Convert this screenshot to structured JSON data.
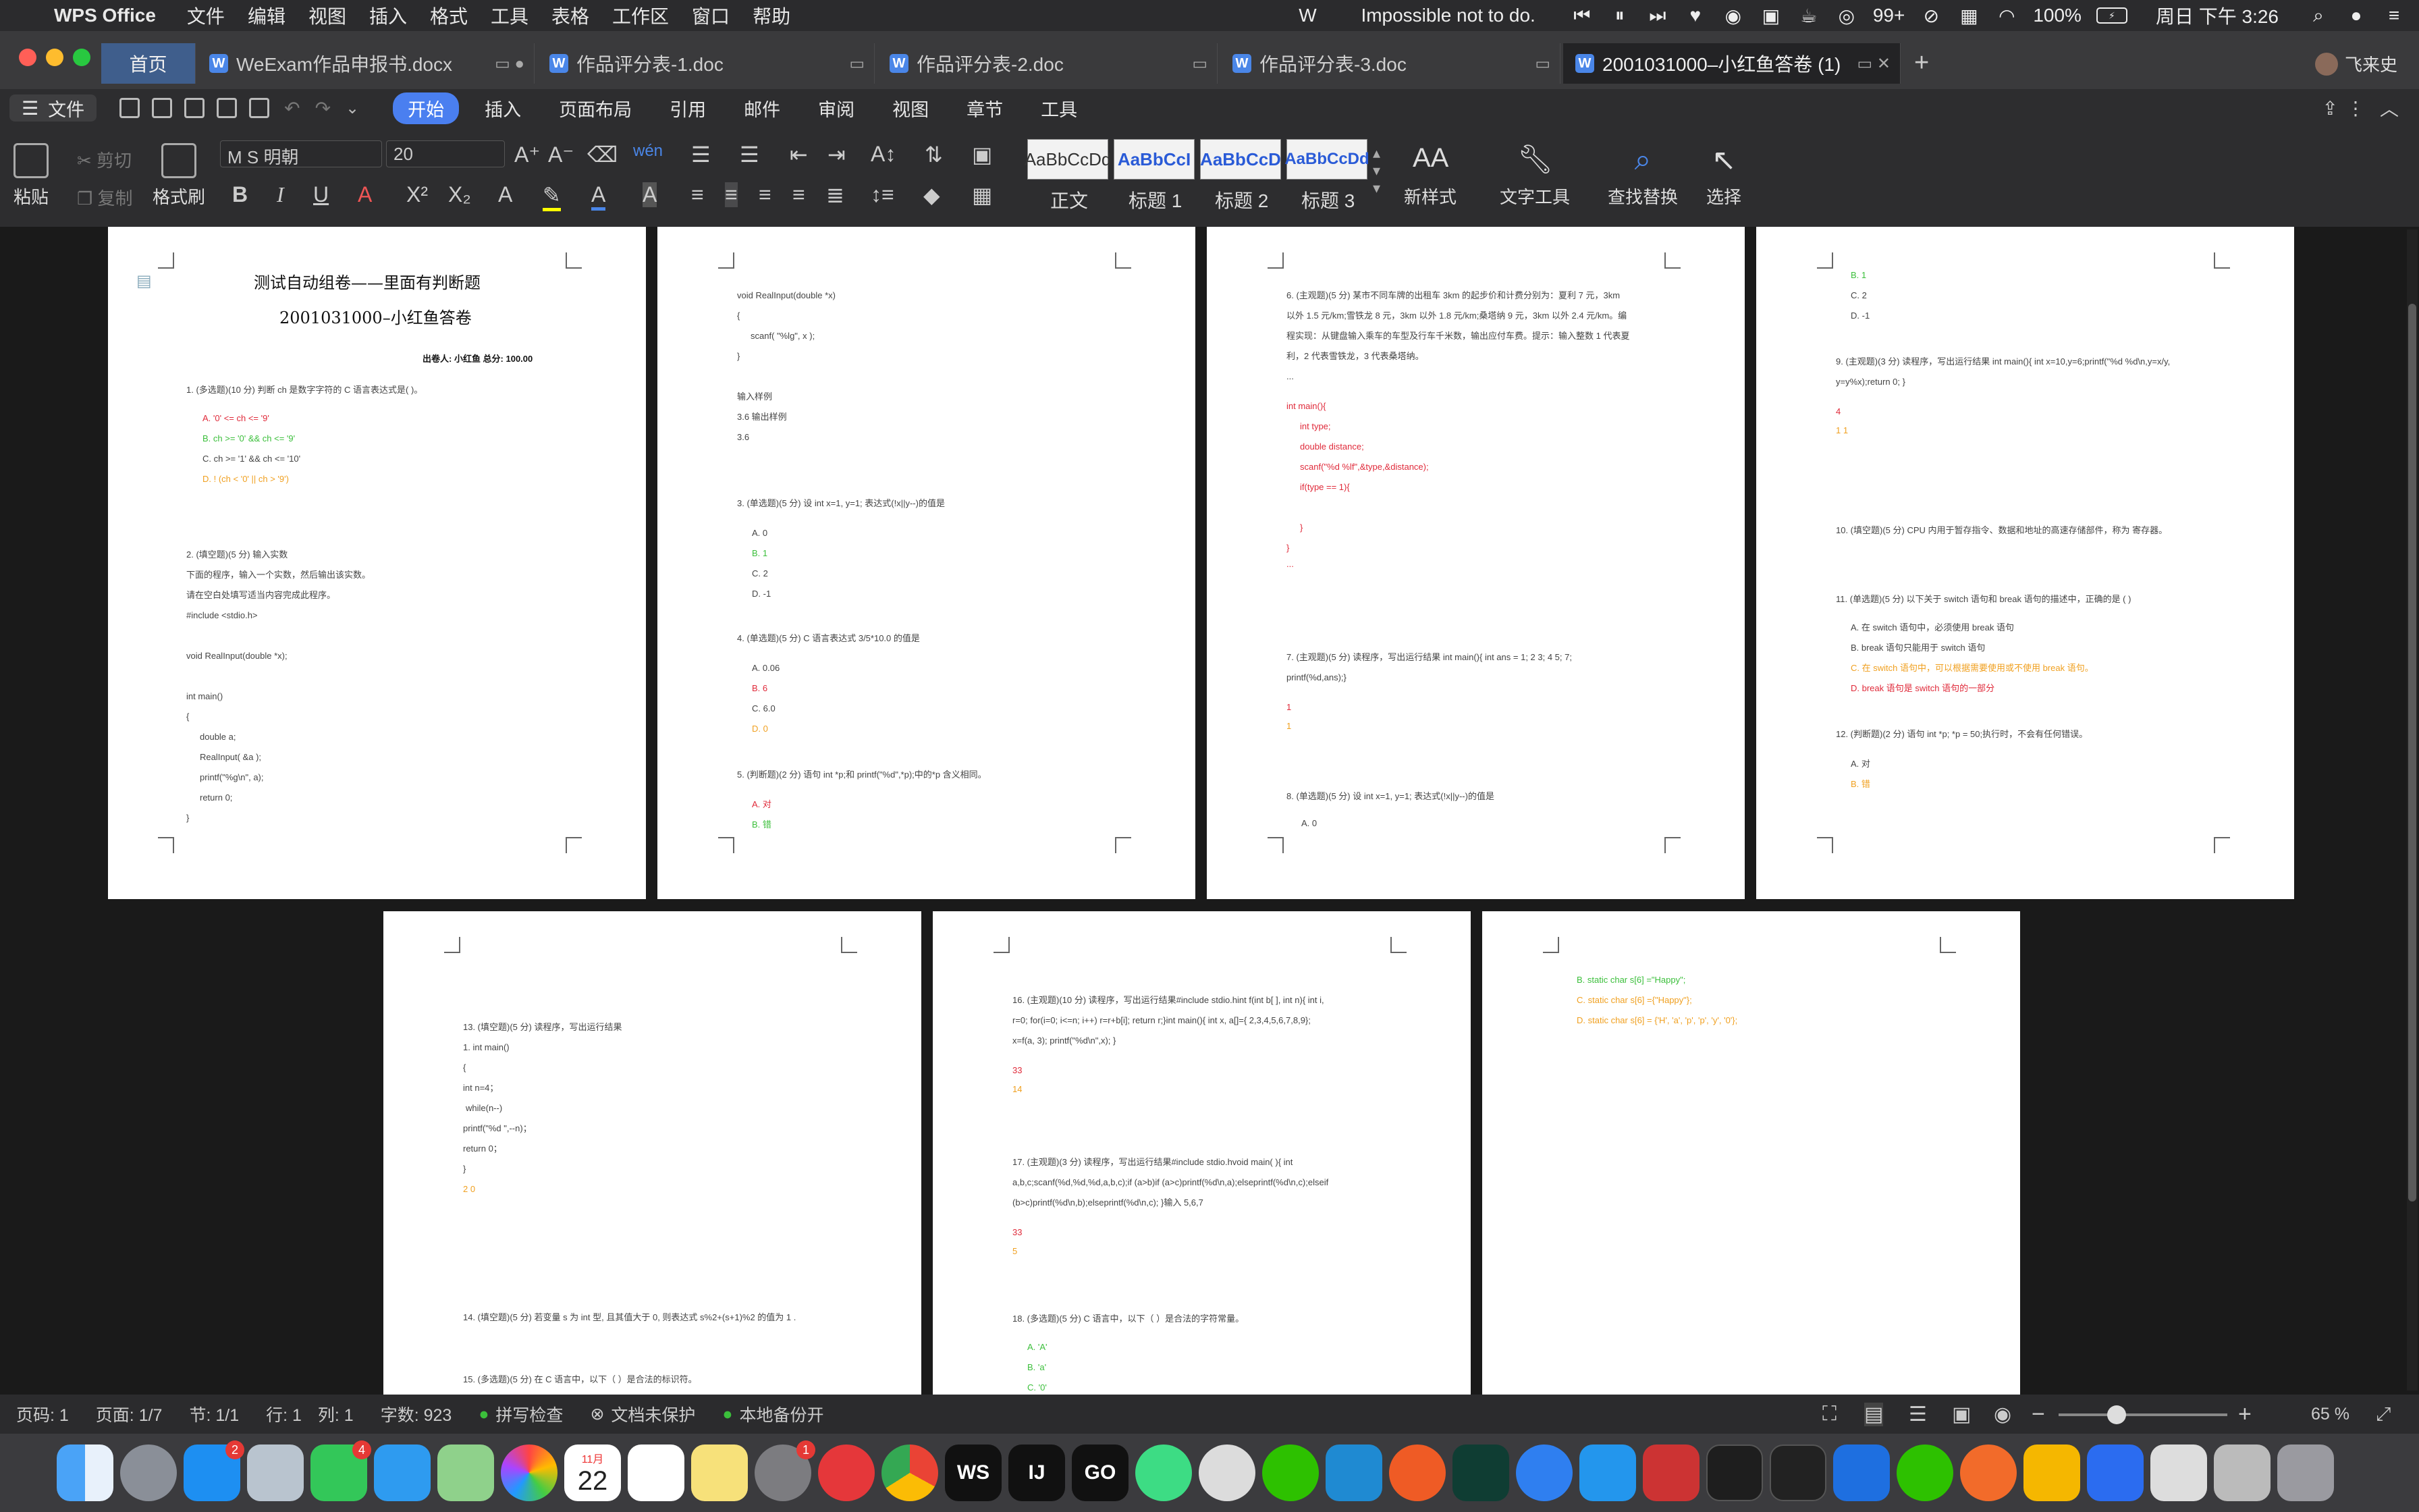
{
  "menubar": {
    "app": "WPS Office",
    "items": [
      "文件",
      "编辑",
      "视图",
      "插入",
      "格式",
      "工具",
      "表格",
      "工作区",
      "窗口",
      "帮助"
    ],
    "now_playing": "Impossible not to do.",
    "badge": "99+",
    "battery": "100%",
    "clock": "周日 下午 3:26"
  },
  "tabs": {
    "home": "首页",
    "items": [
      "WeExam作品申报书.docx",
      "作品评分表-1.doc",
      "作品评分表-2.doc",
      "作品评分表-3.doc",
      "2001031000–小红鱼答卷 (1)"
    ],
    "add": "+",
    "user": "飞来史"
  },
  "menurow": {
    "file": "文件",
    "tabs": [
      "开始",
      "插入",
      "页面布局",
      "引用",
      "邮件",
      "审阅",
      "视图",
      "章节",
      "工具"
    ]
  },
  "ribbon": {
    "paste": "粘贴",
    "cut": "剪切",
    "copy": "复制",
    "format_painter": "格式刷",
    "font_name": "M S 明朝",
    "font_size": "20",
    "styles": [
      {
        "preview": "AaBbCcDd",
        "label": "正文"
      },
      {
        "preview": "AaBbCcI",
        "label": "标题 1"
      },
      {
        "preview": "AaBbCcD",
        "label": "标题 2"
      },
      {
        "preview": "AaBbCcDd",
        "label": "标题 3"
      }
    ],
    "new_style": "新样式",
    "text_tools": "文字工具",
    "find_replace": "查找替换",
    "select": "选择"
  },
  "pages": {
    "p1": {
      "title": "测试自动组卷——里面有判断题",
      "subtitle": "2001031000–小红鱼答卷",
      "meta": "出卷人: 小红鱼  总分: 100.00",
      "q1": "1. (多选题)(10 分) 判断 ch 是数字字符的 C 语言表达式是( )。",
      "q1a": "A. '0' <= ch <= '9'",
      "q1b": "B. ch >= '0' && ch <= '9'",
      "q1c": "C. ch >= '1' && ch <= '10'",
      "q1d": "D. ! (ch < '0' || ch > '9')",
      "q2": "2. (填空题)(5 分) 输入实数",
      "q2l1": "下面的程序，输入一个实数，然后输出该实数。",
      "q2l2": "请在空白处填写适当内容完成此程序。",
      "q2l3": "#include <stdio.h>",
      "q2l4": "void RealInput(double *x);",
      "q2l5": "int main()",
      "q2l6": "{",
      "q2l7": "double a;",
      "q2l8": "RealInput( &a );",
      "q2l9": "printf(\"%g\\n\", a);",
      "q2l10": "return 0;",
      "q2l11": "}"
    },
    "p2": {
      "l1": "void RealInput(double *x)",
      "l2": "{",
      "l3": "scanf( \"%lg\", x );",
      "l4": "}",
      "l5": "输入样例",
      "l6": "3.6 输出样例",
      "l7": "3.6",
      "q3": "3. (单选题)(5 分) 设 int x=1, y=1; 表达式(!x||y--)的值是",
      "q3a": "A. 0",
      "q3b": "B. 1",
      "q3c": "C. 2",
      "q3d": "D. -1",
      "q4": "4. (单选题)(5 分) C 语言表达式 3/5*10.0 的值是",
      "q4a": "A. 0.06",
      "q4b": "B. 6",
      "q4c": "C. 6.0",
      "q4d": "D. 0",
      "q5": "5. (判断题)(2 分) 语句 int *p;和 printf(\"%d\",*p);中的*p 含义相同。",
      "q5a": "A. 对",
      "q5b": "B. 错"
    },
    "p3": {
      "q6l1": "6. (主观题)(5 分) 某市不同车牌的出租车 3km 的起步价和计费分别为：夏利 7 元，3km",
      "q6l2": "以外 1.5 元/km;雪铁龙 8 元，3km 以外 1.8 元/km;桑塔纳 9 元，3km 以外 2.4 元/km。编",
      "q6l3": "程实现：从键盘输入乘车的车型及行车千米数，输出应付车费。提示：输入整数 1 代表夏",
      "q6l4": "利，2 代表雪铁龙，3 代表桑塔纳。",
      "q6l5": "...",
      "c1": "int main(){",
      "c2": "int type;",
      "c3": "double distance;",
      "c4": "scanf(\"%d %lf\",&type,&distance);",
      "c5": "if(type == 1){",
      "c6": "}",
      "c7": "}",
      "c8": "...",
      "q7l1": "7. (主观题)(5 分) 读程序，写出运行结果 int main(){  int ans = 1; 2  3; 4  5; 7;",
      "q7l2": "printf(%d,ans);}",
      "q7a1": "1",
      "q7a2": "1",
      "q8": "8. (单选题)(5 分) 设 int x=1, y=1; 表达式(!x||y--)的值是",
      "q8a": "A. 0"
    },
    "p4": {
      "b": "B. 1",
      "c": "C. 2",
      "d": "D. -1",
      "q9l1": "9. (主观题)(3 分) 读程序，写出运行结果 int main(){ int x=10,y=6;printf(\"%d %d\\n,y=x/y,",
      "q9l2": "y=y%x);return 0; }",
      "q9a1": "4",
      "q9a2": "1 1",
      "q10": "10. (填空题)(5 分) CPU 内用于暂存指令、数据和地址的高速存储部件，称为 寄存器。",
      "q11": "11. (单选题)(5 分) 以下关于 switch 语句和 break 语句的描述中，正确的是 ( )",
      "q11a": "A. 在 switch 语句中，必须使用 break 语句",
      "q11b": "B. break 语句只能用于 switch 语句",
      "q11c": "C. 在 switch 语句中，可以根据需要使用或不使用 break 语句。",
      "q11d": "D. break 语句是 switch 语句的一部分",
      "q12": "12. (判断题)(2 分) 语句 int *p; *p = 50;执行时，不会有任何错误。",
      "q12a": "A. 对",
      "q12b": "B. 错"
    },
    "p5": {
      "q13": "13. (填空题)(5 分) 读程序，写出运行结果",
      "l1": "1. int main()",
      "l2": "{",
      "l3": "int n=4；",
      "l4": "while(n--)",
      "l5": "printf(\"%d \",--n)；",
      "l6": "return 0；",
      "l7": "}",
      "ans": "2 0",
      "q14": "14. (填空题)(5 分) 若变量 s 为 int 型, 且其值大于 0, 则表达式 s%2+(s+1)%2 的值为 1 .",
      "q15": "15. (多选题)(5 分) 在 C 语言中，以下（ ）是合法的标识符。"
    },
    "p6": {
      "q16l1": "16. (主观题)(10 分) 读程序，写出运行结果#include stdio.hint f(int b[ ], int n){   int i,",
      "q16l2": "r=0;  for(i=0; i<=n; i++)   r=r+b[i];   return r;}int main(){    int x, a[]={ 2,3,4,5,6,7,8,9};",
      "q16l3": "x=f(a, 3);  printf(\"%d\\n\",x);  }",
      "q16a1": "33",
      "q16a2": "14",
      "q17l1": "17. (主观题)(3 分) 读程序，写出运行结果#include stdio.hvoid main( ){ int",
      "q17l2": "a,b,c;scanf(%d,%d,%d,a,b,c);if (a>b)if (a>c)printf(%d\\n,a);elseprintf(%d\\n,c);elseif",
      "q17l3": "(b>c)printf(%d\\n,b);elseprintf(%d\\n,c); }输入 5,6,7",
      "q17a1": "33",
      "q17a2": "5",
      "q18": "18. (多选题)(5 分) C 语言中，以下（ ）是合法的字符常量。",
      "q18a": "A. 'A'",
      "q18b": "B. 'a'",
      "q18c": "C. '0'"
    },
    "p7": {
      "b": "B. static char s[6] =\"Happy\";",
      "c": "C. static char s[6] ={\"Happy\"};",
      "d": "D. static char s[6] = {'H', 'a', 'p', 'p', 'y', '0'};"
    }
  },
  "statusbar": {
    "page": "页码: 1",
    "pages": "页面: 1/7",
    "section": "节: 1/1",
    "row": "行: 1",
    "col": "列: 1",
    "words": "字数: 923",
    "spell": "拼写检查",
    "protect": "文档未保护",
    "backup": "本地备份开",
    "zoom": "65 %"
  },
  "colors": {
    "accent": "#4a7ff0",
    "correct": "#3bbf3b",
    "wrong": "#e02a3a",
    "student": "#f0a020"
  },
  "dock": {
    "badge_appstore": "2",
    "badge_facetime": "4",
    "badge_settings": "1",
    "calendar_day": "22",
    "calendar_month": "11月"
  }
}
